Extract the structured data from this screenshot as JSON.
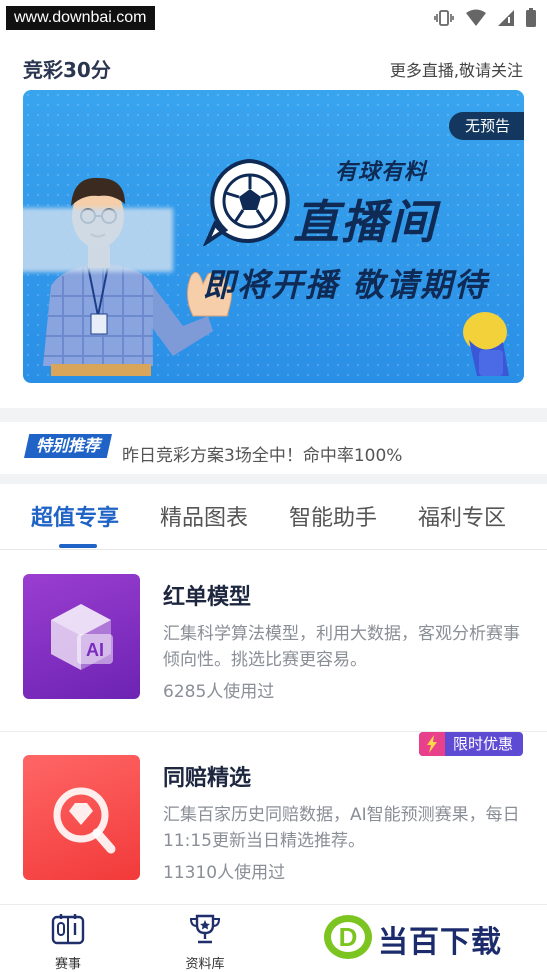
{
  "status_bar": {
    "watermark_url": "www.downbai.com"
  },
  "header": {
    "title": "竞彩30分",
    "more_link": "更多直播,敬请关注"
  },
  "banner": {
    "badge": "无预告",
    "subtitle": "有球有料",
    "main_title": "直播间",
    "slogan": "即将开播 敬请期待"
  },
  "recommend": {
    "tag": "特别推荐",
    "text": "昨日竞彩方案3场全中！命中率100%"
  },
  "tabs": [
    {
      "label": "超值专享",
      "active": true
    },
    {
      "label": "精品图表",
      "active": false
    },
    {
      "label": "智能助手",
      "active": false
    },
    {
      "label": "福利专区",
      "active": false
    }
  ],
  "cards": [
    {
      "title": "红单模型",
      "description": "汇集科学算法模型，利用大数据，客观分析赛事倾向性。挑选比赛更容易。",
      "usage": "6285人使用过",
      "icon": "ai-cube-icon",
      "color": "#7b2cbf"
    },
    {
      "title": "同赔精选",
      "description": "汇集百家历史同赔数据，AI智能预测赛果，每日11:15更新当日精选推荐。",
      "usage": "11310人使用过",
      "badge": "限时优惠",
      "icon": "diamond-search-icon",
      "color": "#f44343"
    }
  ],
  "bottom_nav": [
    {
      "label": "赛事",
      "icon": "scoreboard-icon"
    },
    {
      "label": "资料库",
      "icon": "trophy-icon"
    }
  ],
  "site_logo": {
    "letter": "D",
    "text": "当百下载"
  },
  "colors": {
    "accent": "#1f63c6",
    "banner_blue": "#2f97ea",
    "title_dark": "#1e2740"
  }
}
